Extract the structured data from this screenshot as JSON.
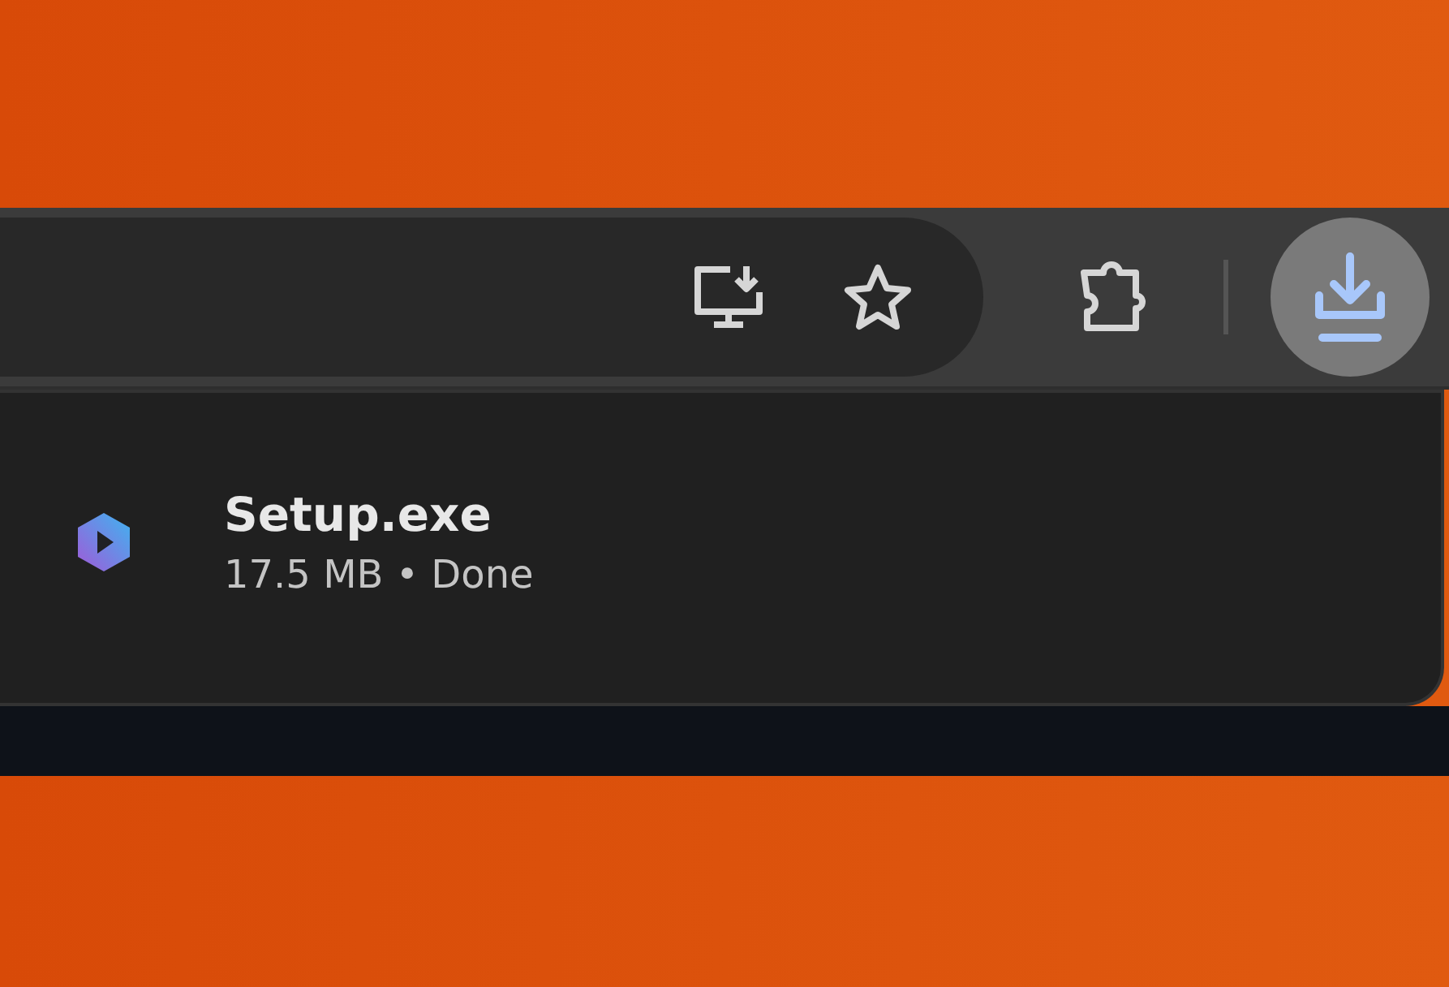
{
  "toolbar": {
    "downloads_button": {
      "selected": true
    }
  },
  "downloads_panel": {
    "items": [
      {
        "name": "Setup.exe",
        "details": "17.5 MB • Done"
      }
    ]
  }
}
